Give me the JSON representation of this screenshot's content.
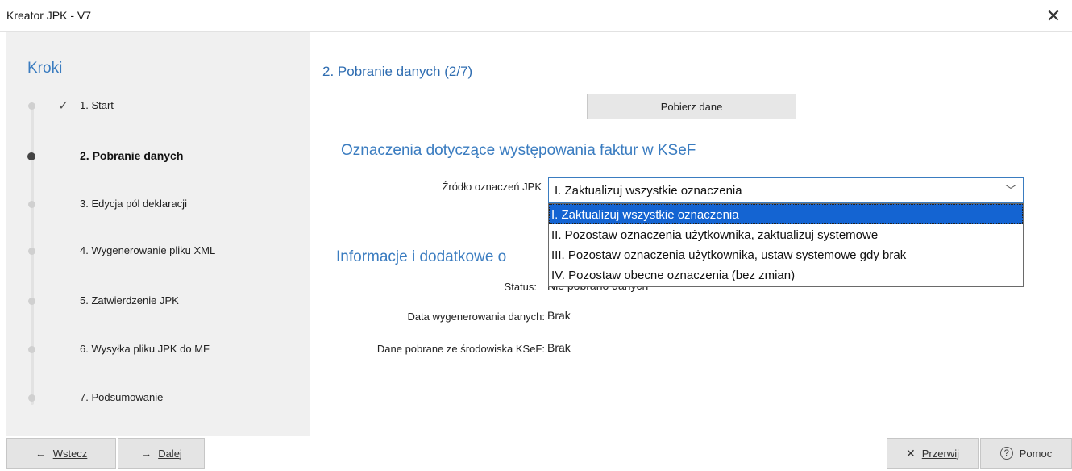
{
  "window": {
    "title": "Kreator JPK - V7",
    "close_glyph": "✕"
  },
  "sidebar": {
    "heading": "Kroki",
    "steps": [
      {
        "label": "1. Start",
        "done_glyph": "✓"
      },
      {
        "label": "2. Pobranie danych"
      },
      {
        "label": "3. Edycja pól deklaracji"
      },
      {
        "label": "4. Wygenerowanie pliku XML"
      },
      {
        "label": "5. Zatwierdzenie JPK"
      },
      {
        "label": "6. Wysyłka pliku JPK do MF"
      },
      {
        "label": "7. Podsumowanie"
      }
    ],
    "active_step": 2
  },
  "main": {
    "title": "2. Pobranie danych (2/7)",
    "fetch_button": "Pobierz dane",
    "section_ksef": "Oznaczenia dotyczące występowania faktur w KSeF",
    "source_label": "Źródło oznaczeń JPK",
    "source_selected": "I.  Zaktualizuj wszystkie oznaczenia",
    "source_options": [
      "I.  Zaktualizuj wszystkie oznaczenia",
      "II.  Pozostaw oznaczenia użytkownika, zaktualizuj systemowe",
      "III. Pozostaw oznaczenia użytkownika, ustaw systemowe gdy brak",
      "IV.  Pozostaw obecne oznaczenia  (bez zmian)"
    ],
    "section_info": "Informacje i dodatkowe o",
    "status_label": "Status:",
    "status_value": "Nie pobrano danych",
    "gen_date_label": "Data wygenerowania danych:",
    "gen_date_value": "Brak",
    "ksef_env_label": "Dane pobrane ze środowiska KSeF:",
    "ksef_env_value": "Brak"
  },
  "footer": {
    "back": "Wstecz",
    "next": "Dalej",
    "cancel": "Przerwij",
    "help": "Pomoc",
    "back_icon": "←",
    "next_icon": "→",
    "cancel_icon": "✕",
    "help_icon": "?"
  },
  "colors": {
    "accent": "#3a7cc0",
    "selection": "#1464d2"
  }
}
